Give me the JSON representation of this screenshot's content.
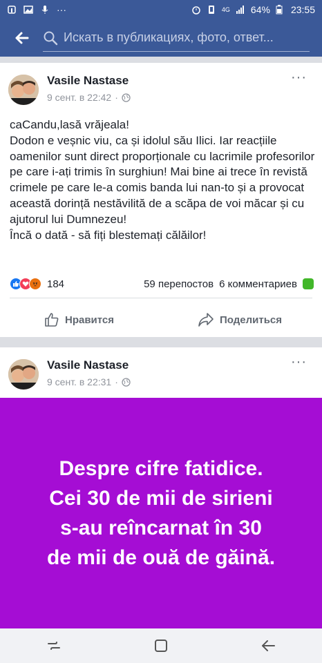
{
  "status_bar": {
    "battery_percent": "64%",
    "time": "23:55",
    "network": "4G"
  },
  "search": {
    "placeholder": "Искать в публикациях, фото, ответ..."
  },
  "posts": [
    {
      "author": "Vasile Nastase",
      "date": "9 сент. в 22:42",
      "privacy_separator": "·",
      "more_label": "···",
      "text_lines": [
        "caCandu,lasă vrăjeala!",
        "Dodon e veșnic viu, ca și idolul său Ilici. Iar reacțiile oamenilor sunt direct proporționale cu lacrimile profesorilor pe care i-ați trimis în surghiun! Mai bine ai trece în revistă crimele pe care le-a comis banda lui nan-to și a provocat această dorință nestăvilită de a scăpa de voi măcar și cu ajutorul lui Dumnezeu!",
        "Încă o dată - să fiți blestemați călăilor!"
      ],
      "reaction_count": "184",
      "reposts": "59 перепостов",
      "comments": "6 комментариев",
      "like_label": "Нравится",
      "share_label": "Поделиться"
    },
    {
      "author": "Vasile Nastase",
      "date": "9 сент. в 22:31",
      "privacy_separator": "·",
      "more_label": "···",
      "banner_lines": [
        "Despre cifre fatidice.",
        "Cei 30 de mii de sirieni",
        "s-au reîncarnat în 30",
        "de mii de ouă de găină."
      ],
      "banner_color": "#a50dd4"
    }
  ],
  "colors": {
    "facebook_blue": "#3b5998",
    "like_blue": "#1877f2",
    "love_red": "#f33e58",
    "angry_orange": "#e9710f",
    "comment_green": "#42b72a"
  }
}
